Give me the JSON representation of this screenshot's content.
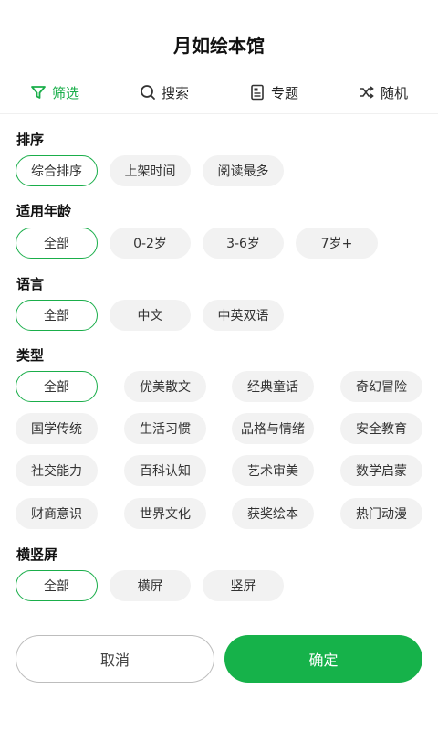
{
  "app": {
    "title": "月如绘本馆"
  },
  "tabs": [
    {
      "label": "筛选",
      "icon": "filter-icon",
      "active": true
    },
    {
      "label": "搜索",
      "icon": "search-icon",
      "active": false
    },
    {
      "label": "专题",
      "icon": "document-icon",
      "active": false
    },
    {
      "label": "随机",
      "icon": "shuffle-icon",
      "active": false
    }
  ],
  "sections": {
    "sort": {
      "title": "排序",
      "options": [
        "综合排序",
        "上架时间",
        "阅读最多"
      ],
      "selected": "综合排序"
    },
    "age": {
      "title": "适用年龄",
      "options": [
        "全部",
        "0-2岁",
        "3-6岁",
        "7岁+"
      ],
      "selected": "全部"
    },
    "language": {
      "title": "语言",
      "options": [
        "全部",
        "中文",
        "中英双语"
      ],
      "selected": "全部"
    },
    "category": {
      "title": "类型",
      "options": [
        "全部",
        "优美散文",
        "经典童话",
        "奇幻冒险",
        "国学传统",
        "生活习惯",
        "品格与情绪",
        "安全教育",
        "社交能力",
        "百科认知",
        "艺术审美",
        "数学启蒙",
        "财商意识",
        "世界文化",
        "获奖绘本",
        "热门动漫"
      ],
      "selected": "全部"
    },
    "orientation": {
      "title": "横竖屏",
      "options": [
        "全部",
        "横屏",
        "竖屏"
      ],
      "selected": "全部"
    }
  },
  "actions": {
    "cancel": "取消",
    "confirm": "确定"
  },
  "colors": {
    "accent": "#1aae4a",
    "chip_bg": "#f2f2f2"
  }
}
